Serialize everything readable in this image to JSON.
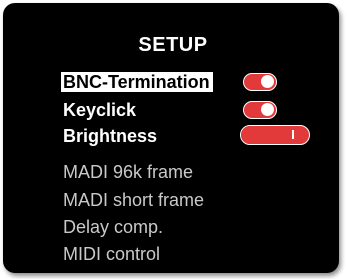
{
  "screen": {
    "title": "SETUP"
  },
  "menu": {
    "items": [
      {
        "label": "BNC-Termination",
        "type": "toggle",
        "on": true,
        "enabled": true,
        "selected": true
      },
      {
        "label": "Keyclick",
        "type": "toggle",
        "on": true,
        "enabled": true,
        "selected": false
      },
      {
        "label": "Brightness",
        "type": "slider",
        "level": 0.85,
        "enabled": true,
        "selected": false
      },
      {
        "label": "MADI 96k frame",
        "enabled": false
      },
      {
        "label": "MADI short frame",
        "enabled": false
      },
      {
        "label": "Delay comp.",
        "enabled": false
      },
      {
        "label": "MIDI control",
        "enabled": false
      }
    ]
  },
  "colors": {
    "background": "#000000",
    "active_text": "#ffffff",
    "inactive_text": "#c9c9c9",
    "accent": "#e23a3a"
  }
}
